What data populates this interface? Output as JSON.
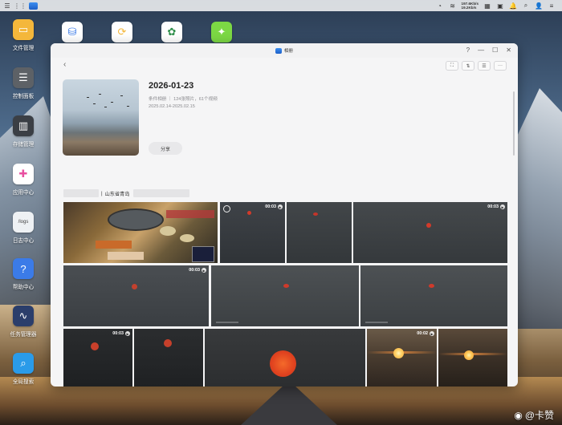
{
  "topbar": {
    "upload_speed": "197.6Kb/s",
    "download_speed": "19.2Kb/s"
  },
  "desktop_icons": [
    {
      "label": "文件管理",
      "icon": "folder-icon",
      "color": "#f4b73b"
    },
    {
      "label": "控制面板",
      "icon": "control-panel-icon",
      "color": "#5d6166"
    },
    {
      "label": "存储管理",
      "icon": "storage-icon",
      "color": "#3b3f45"
    },
    {
      "label": "应用中心",
      "icon": "app-center-icon",
      "color": "#ffffff"
    },
    {
      "label": "日志中心",
      "icon": "log-icon",
      "color": "#eef1f4"
    },
    {
      "label": "帮助中心",
      "icon": "help-icon",
      "color": "#3b7be8"
    },
    {
      "label": "任务管理器",
      "icon": "task-manager-icon",
      "color": "#2b3e6b"
    },
    {
      "label": "全局搜索",
      "icon": "search-icon",
      "color": "#2a9be9"
    }
  ],
  "log_icon_text": "/logs",
  "window": {
    "title": "相册",
    "album": {
      "title": "2026-01-23",
      "meta": "条件相册 ｜ 124张照片，61个视频",
      "date_range": "2025.02.14-2025.02.15",
      "share_label": "分享"
    },
    "location": "山东省青岛",
    "photos": [
      {
        "type": "photo"
      },
      {
        "type": "video",
        "duration": "00:03"
      },
      {
        "type": "photo"
      },
      {
        "type": "video",
        "duration": "00:03"
      },
      {
        "type": "video",
        "duration": "00:03"
      },
      {
        "type": "photo"
      },
      {
        "type": "photo"
      },
      {
        "type": "video",
        "duration": "00:03"
      },
      {
        "type": "photo"
      },
      {
        "type": "photo"
      },
      {
        "type": "video",
        "duration": "00:02"
      },
      {
        "type": "photo"
      }
    ]
  },
  "watermark": "@卡赞"
}
